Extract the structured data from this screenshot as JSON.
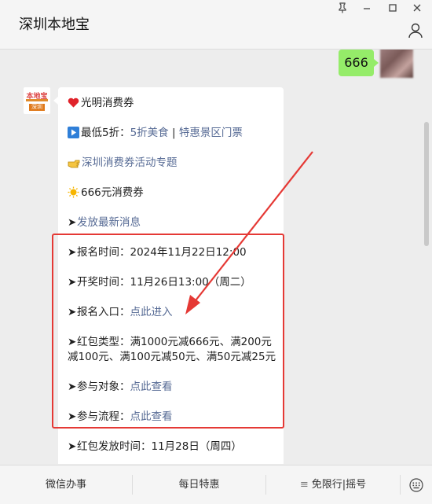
{
  "app": {
    "title": "深圳本地宝",
    "window_controls": [
      "pin",
      "minimize",
      "maximize",
      "close"
    ]
  },
  "chat": {
    "my_message": "666",
    "reply": {
      "lines": [
        {
          "icon": "heart-icon",
          "text": "光明消费券"
        },
        {
          "icon": "play-icon",
          "prefix": "最低5折：",
          "link1": "5折美食",
          "sep": " | ",
          "link2": "特惠景区门票"
        },
        {
          "icon": "pointing-hand-icon",
          "link": "深圳消费券活动专题"
        },
        {
          "icon": "sun-icon",
          "text": "666元消费券"
        },
        {
          "arrow": "➤",
          "link": "发放最新消息"
        }
      ],
      "highlight_box_lines": [
        {
          "arrow": "➤",
          "text": "报名时间：2024年11月22日12:00"
        },
        {
          "arrow": "➤",
          "text": "开奖时间：11月26日13:00（周二）"
        },
        {
          "arrow": "➤",
          "prefix": "报名入口：",
          "link": "点此进入"
        },
        {
          "arrow": "➤",
          "text_line1": "红包类型：满1000元减666元、满200元",
          "text_line2": "减100元、满100元减50元、满50元减25元"
        },
        {
          "arrow": "➤",
          "prefix": "参与对象：",
          "link": "点此查看"
        },
        {
          "arrow": "➤",
          "prefix": "参与流程：",
          "link": "点此查看"
        }
      ],
      "after_box_line": {
        "arrow": "➤",
        "text": "红包发放时间：11月28日（周四）"
      }
    }
  },
  "bottom_menu": {
    "items": [
      "微信办事",
      "每日特惠",
      "免限行|摇号"
    ],
    "menu_prefix_icon": "≡",
    "keyboard_icon": "keyboard-icon"
  },
  "colors": {
    "link": "#576b95",
    "highlight": "#e53935",
    "my_bubble": "#95ec69"
  }
}
